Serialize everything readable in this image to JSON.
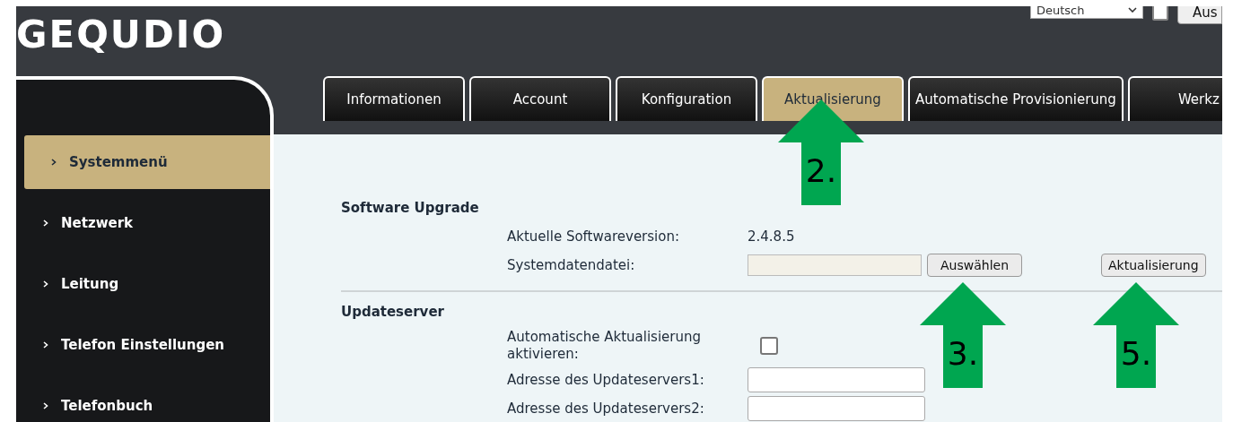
{
  "logo": "GEQUDIO",
  "language": {
    "value": "Deutsch"
  },
  "top_checkbox": {
    "checked": false
  },
  "logout_button": "Aus",
  "tabs": [
    {
      "label": "Informationen",
      "selected": false
    },
    {
      "label": "Account",
      "selected": false
    },
    {
      "label": "Konfiguration",
      "selected": false
    },
    {
      "label": "Aktualisierung",
      "selected": true
    },
    {
      "label": "Automatische Provisionierung",
      "selected": false
    },
    {
      "label": "Werkz",
      "selected": false
    }
  ],
  "sidebar": {
    "items": [
      {
        "label": "Systemmenü",
        "selected": true
      },
      {
        "label": "Netzwerk",
        "selected": false
      },
      {
        "label": "Leitung",
        "selected": false
      },
      {
        "label": "Telefon Einstellungen",
        "selected": false
      },
      {
        "label": "Telefonbuch",
        "selected": false
      }
    ]
  },
  "sections": [
    {
      "title": "Software Upgrade",
      "rows": [
        {
          "kind": "text",
          "label": "Aktuelle Softwareversion:",
          "value": "2.4.8.5"
        },
        {
          "kind": "file",
          "label": "Systemdatendatei:",
          "button": "Auswählen",
          "action": "Aktualisierung"
        }
      ]
    },
    {
      "title": "Updateserver",
      "rows": [
        {
          "kind": "checkbox",
          "label": "Automatische Aktualisierung aktivieren:",
          "checked": false
        },
        {
          "kind": "input",
          "label": "Adresse des Updateservers1:"
        },
        {
          "kind": "input",
          "label": "Adresse des Updateservers2:"
        }
      ]
    }
  ],
  "annotations": [
    {
      "label": "2."
    },
    {
      "label": "3."
    },
    {
      "label": "5."
    }
  ]
}
